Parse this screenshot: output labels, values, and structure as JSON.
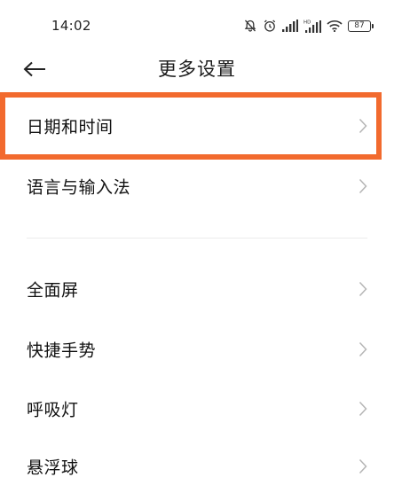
{
  "status_bar": {
    "time": "14:02",
    "battery": "87",
    "icons": [
      "mute-bell-icon",
      "alarm-icon",
      "signal-icon",
      "hd-signal-icon",
      "wifi-icon",
      "battery-icon"
    ]
  },
  "header": {
    "title": "更多设置",
    "back_icon": "arrow-left-icon"
  },
  "menu": {
    "group1": [
      {
        "label": "日期和时间",
        "highlighted": true
      },
      {
        "label": "语言与输入法"
      }
    ],
    "group2": [
      {
        "label": "全面屏"
      },
      {
        "label": "快捷手势"
      },
      {
        "label": "呼吸灯"
      },
      {
        "label": "悬浮球"
      }
    ]
  },
  "colors": {
    "highlight": "#f26a2e",
    "chevron": "#b5b5b5",
    "text": "#111111"
  }
}
